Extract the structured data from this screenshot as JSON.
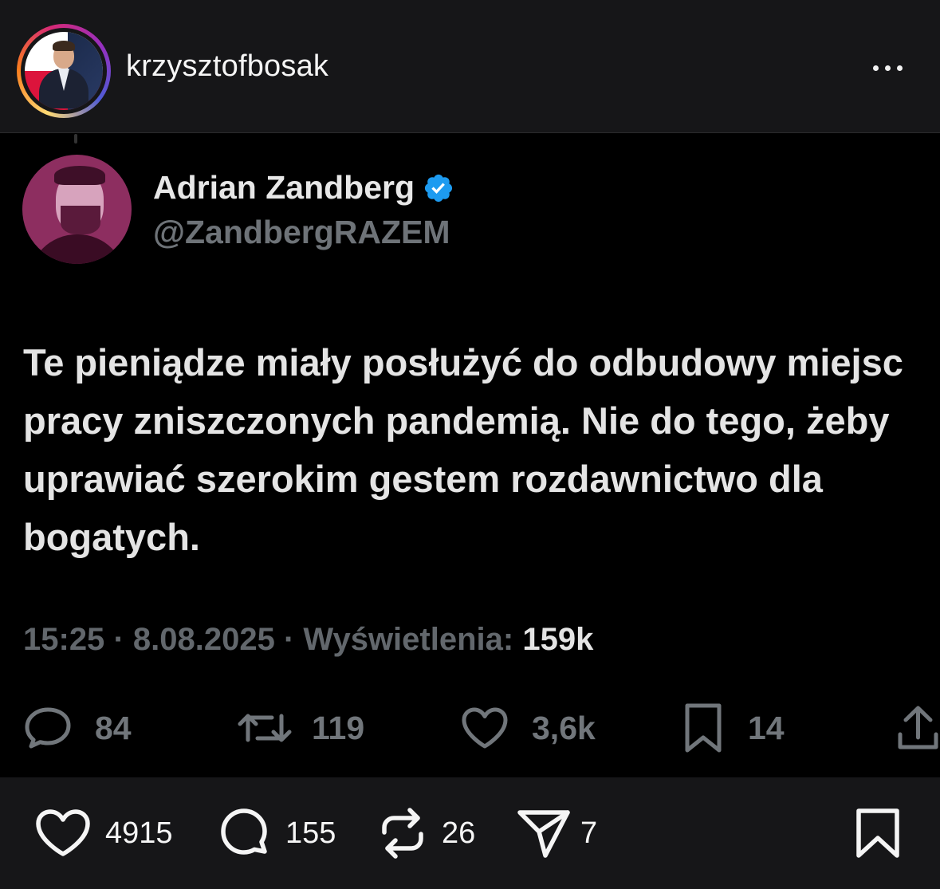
{
  "post": {
    "username": "krzysztofbosak"
  },
  "tweet": {
    "author_name": "Adrian Zandberg",
    "handle": "@ZandbergRAZEM",
    "verified": true,
    "text": "Te pieniądze miały posłużyć do odbudowy miejsc pracy zniszczonych pandemią. Nie do tego, żeby uprawiać szerokim gestem rozdawnictwo dla bogatych.",
    "time": "15:25",
    "date": "8.08.2025",
    "views_label": "Wyświetlenia:",
    "views": "159k",
    "separator": "·",
    "replies": "84",
    "retweets": "119",
    "likes": "3,6k",
    "bookmarks": "14"
  },
  "footer": {
    "likes": "4915",
    "comments": "155",
    "reposts": "26",
    "shares": "7"
  },
  "colors": {
    "background": "#000000",
    "header_bg": "#161618",
    "verified_blue": "#1d9bf0",
    "muted_text": "#71767b"
  }
}
